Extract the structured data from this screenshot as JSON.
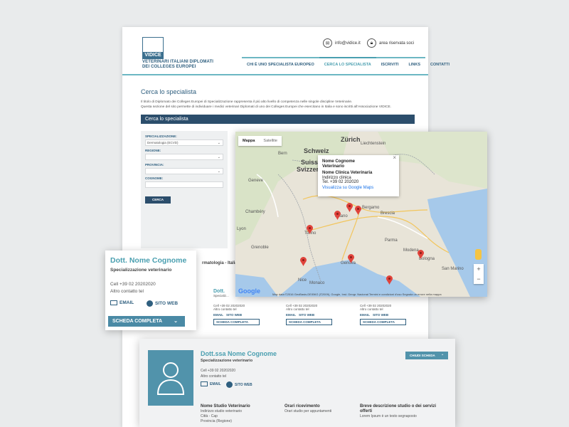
{
  "header": {
    "logo_word": "VIDICE",
    "logo_line1": "VETERINARI ITALIANI DIPLOMATI",
    "logo_line2": "DEI COLLEGES EUROPEI",
    "email": "info@vidice.it",
    "reserved": "area riservata soci"
  },
  "nav": [
    {
      "label": "CHI È UNO SPECIALISTA EUROPEO"
    },
    {
      "label": "CERCA LO SPECIALISTA"
    },
    {
      "label": "ISCRIVITI"
    },
    {
      "label": "LINKS"
    },
    {
      "label": "CONTATTI"
    }
  ],
  "page": {
    "title": "Cerca lo specialista",
    "intro1": "Il titolo di Diplomato dei Colleges Europei di Specializzazione rappresenta il più alto livello di competenza nelle singole discipline Veterinarie.",
    "intro2": "Questa sezione del sito permette di individuare i medici veterinari Diplomati di uno dei Colleges Europei che esercitano in Italia e sono iscritti all'Associazione VIDICE.",
    "bar": "Cerca lo specialista"
  },
  "form": {
    "spec_label": "SPECIALIZZAZIONE:",
    "spec_value": "Dermatologia (ECVD)",
    "region_label": "REGIONE:",
    "prov_label": "PROVINCIA:",
    "name_label": "COGNOME:",
    "search_button": "CERCA"
  },
  "results_heading": "rmatologia - Italia",
  "map": {
    "tab_map": "Mappa",
    "tab_sat": "Satellite",
    "info_name": "Nome Cognome",
    "info_role": "Veterinario",
    "info_clinic": "Nome Clinica Veterinaria",
    "info_address": "Indirizzo clinica",
    "info_tel": "Tel. +39 02 202020",
    "info_link": "Visualizza su Google Maps",
    "attribution": "Map data ©2016 GeoBasis-DE/BKG (©2009), Google, Inst. Geogr. Nacional   Termini e condizioni d'uso   Segnala un errore nella mappa",
    "google": "Google",
    "labels": [
      "Schweiz",
      "Suisse",
      "Svizzera",
      "Liechtenstein",
      "Milano",
      "Torino",
      "Genova",
      "Bologna",
      "Bergamo",
      "Brescia",
      "Parma",
      "Modena",
      "Nice",
      "Monaco",
      "Geneve",
      "Lyon",
      "Grenoble",
      "Chambéry",
      "Turin",
      "San Marino",
      "Bern",
      "Zürich"
    ]
  },
  "card_small": {
    "name": "Dott. Nome Cognome",
    "spec": "Specializzazione veterinario",
    "cell": "Cell +39 02 20202020",
    "other": "Altro contatto tel",
    "email": "EMAIL",
    "site": "SITO WEB",
    "button": "SCHEDA COMPLETA"
  },
  "cards_grid": [
    {
      "name": "Dott.",
      "spec": "Specializ...",
      "cell": "Cell +39 02 20202020",
      "other": "Altro contatto tel",
      "email": "EMAIL",
      "site": "SITO WEB",
      "button": "SCHEDA COMPLETA"
    },
    {
      "name": "Dott.ssa Nome Cognome",
      "spec": "Specializzazione veterinario",
      "cell": "Cell +39 02 20202020",
      "other": "Altro contatto tel",
      "email": "EMAIL",
      "site": "SITO WEB",
      "button": "SCHEDA COMPLETA"
    },
    {
      "name": "Dott. Nome Cognome",
      "spec": "Specializzazione veterinario",
      "cell": "Cell +39 02 20202020",
      "other": "Altro contatto tel",
      "email": "EMAIL",
      "site": "SITO WEB",
      "button": "SCHEDA COMPLETA"
    }
  ],
  "card_big": {
    "name": "Dott.ssa Nome Cognome",
    "spec": "Specializzazione veterinario",
    "cell": "Cell +39 02 20202020",
    "other": "Altro contatto tel",
    "email": "EMAIL",
    "site": "SITO WEB",
    "close": "CHIUDI SCHEDA",
    "col1_head": "Nome Studio Veterinario",
    "col1_l1": "Indirizzo studio veterinario",
    "col1_l2": "Città - Cap",
    "col1_l3": "Provincia (Regione)",
    "col2_head": "Orari ricevimento",
    "col2_l1": "Orari studio  per appuntamenti",
    "col3_head": "Breve descrizione studio o dei servizi offerti",
    "col3_l1": "Lorem Ipsum è un testo segnaposto"
  },
  "colors": {
    "accent": "#4a9fb0",
    "navy": "#2c4e6c",
    "pin": "#e0433b"
  }
}
